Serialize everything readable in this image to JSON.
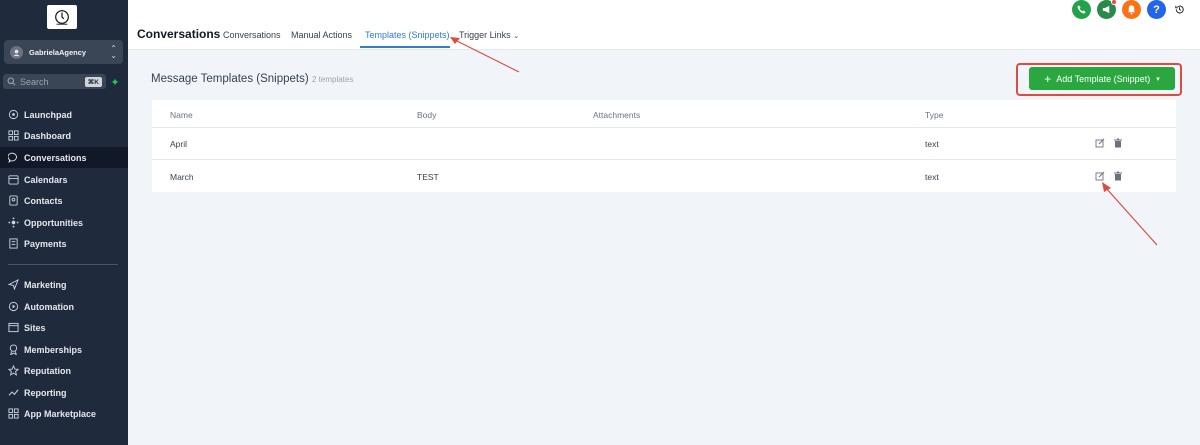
{
  "sidebar": {
    "account_name": "GabrielaAgency",
    "search_placeholder": "Search",
    "search_shortcut": "⌘K",
    "items": [
      {
        "label": "Launchpad",
        "icon": "rocket-icon"
      },
      {
        "label": "Dashboard",
        "icon": "grid-icon"
      },
      {
        "label": "Conversations",
        "icon": "chat-icon",
        "active": true
      },
      {
        "label": "Calendars",
        "icon": "calendar-icon"
      },
      {
        "label": "Contacts",
        "icon": "contacts-icon"
      },
      {
        "label": "Opportunities",
        "icon": "opportunities-icon"
      },
      {
        "label": "Payments",
        "icon": "payments-icon"
      }
    ],
    "items2": [
      {
        "label": "Marketing",
        "icon": "send-icon"
      },
      {
        "label": "Automation",
        "icon": "automation-icon"
      },
      {
        "label": "Sites",
        "icon": "sites-icon"
      },
      {
        "label": "Memberships",
        "icon": "memberships-icon"
      },
      {
        "label": "Reputation",
        "icon": "star-icon"
      },
      {
        "label": "Reporting",
        "icon": "trend-icon"
      },
      {
        "label": "App Marketplace",
        "icon": "apps-icon"
      }
    ]
  },
  "header": {
    "title": "Conversations",
    "tabs": [
      "Conversations",
      "Manual Actions",
      "Templates (Snippets)",
      "Trigger Links"
    ],
    "active_tab": "Templates (Snippets)"
  },
  "main": {
    "section_title": "Message Templates (Snippets)",
    "section_count": "2 templates",
    "add_button_label": "Add Template (Snippet)",
    "columns": [
      "Name",
      "Body",
      "Attachments",
      "Type"
    ],
    "rows": [
      {
        "name": "April",
        "body": "",
        "attachments": "",
        "type": "text"
      },
      {
        "name": "March",
        "body": "TEST",
        "attachments": "",
        "type": "text"
      }
    ]
  },
  "colors": {
    "sidebar_bg": "#1f2a3c",
    "accent_blue": "#2f80c6",
    "button_green": "#2aa83f",
    "annotation_red": "#dc4c42"
  }
}
